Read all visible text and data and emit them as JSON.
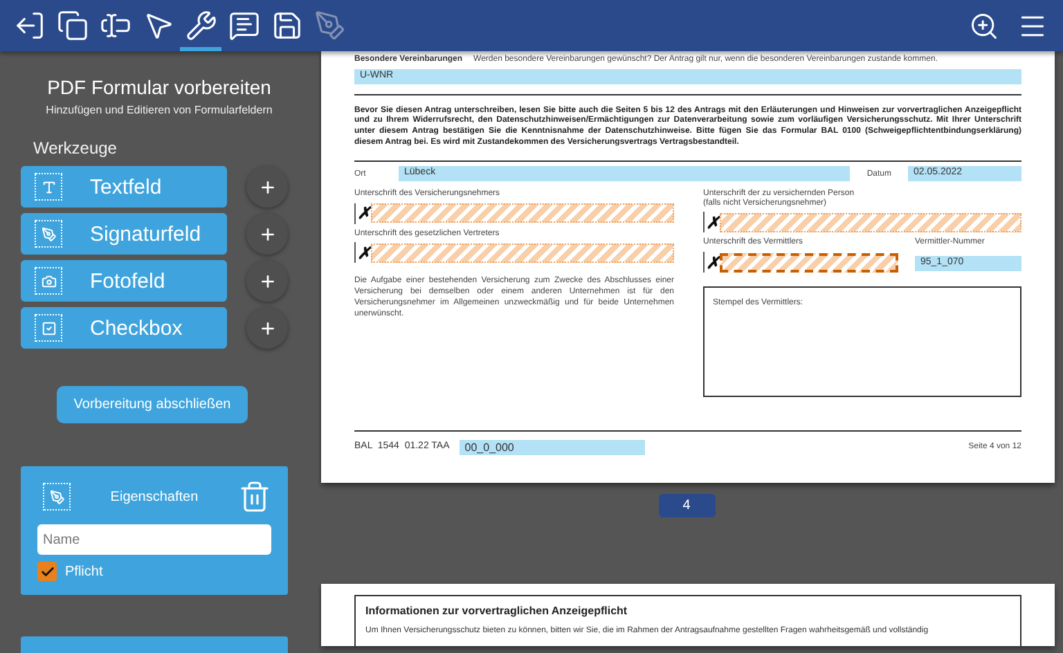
{
  "toolbar": {
    "tools": [
      {
        "kind": "exit",
        "selected": false,
        "disabled": false
      },
      {
        "kind": "pages",
        "selected": false,
        "disabled": false
      },
      {
        "kind": "field",
        "selected": false,
        "disabled": false
      },
      {
        "kind": "pointer",
        "selected": false,
        "disabled": false
      },
      {
        "kind": "tools",
        "selected": true,
        "disabled": false
      },
      {
        "kind": "comment",
        "selected": false,
        "disabled": false
      },
      {
        "kind": "save",
        "selected": false,
        "disabled": false
      },
      {
        "kind": "pen",
        "selected": false,
        "disabled": true
      }
    ],
    "right_tools": [
      {
        "kind": "zoom"
      },
      {
        "kind": "menu"
      }
    ]
  },
  "sidebar": {
    "title": "PDF Formular vorbereiten",
    "subtitle": "Hinzufügen und Editieren von Formularfeldern",
    "tools_heading": "Werkzeuge",
    "tools": [
      {
        "kind": "text",
        "label": "Textfeld"
      },
      {
        "kind": "signature",
        "label": "Signaturfeld"
      },
      {
        "kind": "photo",
        "label": "Fotofeld"
      },
      {
        "kind": "checkbox",
        "label": "Checkbox"
      }
    ],
    "finish_button": "Vorbereitung abschließen",
    "properties": {
      "kind": "signature",
      "title": "Eigenschaften",
      "name_placeholder": "Name",
      "required": {
        "label": "Pflicht",
        "checked": true
      }
    }
  },
  "document": {
    "page": {
      "special_agreements": {
        "label": "Besondere Vereinbarungen",
        "note": "Werden besondere Vereinbarungen gewünscht? Der Antrag gilt nur, wenn die besonderen Vereinbarungen zustande kommen.",
        "value": "U-WNR"
      },
      "notice": "Bevor Sie diesen Antrag unterschreiben, lesen Sie bitte auch die Seiten 5 bis 12 des Antrags mit den Erläuterungen und Hinweisen zur vorvertraglichen Anzeigepflicht und zu Ihrem Widerrufsrecht, den Datenschutzhinweisen/Ermächtigungen zur Datenverarbeitung sowie zum vorläufigen Versicherungsschutz. Mit Ihrer Unterschrift unter diesem Antrag bestätigen Sie die Kenntnisnahme der Datenschutzhinweise. Bitte fügen Sie das Formular BAL 0100 (Schweigepflichtentbindungserklärung) diesem Antrag bei. Es wird mit Zustandekommen des Versicherungsvertrags Vertragsbestandteil.",
      "place": {
        "label": "Ort",
        "value": "Lübeck"
      },
      "date": {
        "label": "Datum",
        "value": "02.05.2022"
      },
      "signatures": [
        {
          "label": "Unterschrift des Versicherungsnehmers",
          "mark": "✗",
          "selected": false
        },
        {
          "label": "Unterschrift der zu versichernden Person\n(falls nicht Versicherungsnehmer)",
          "mark": "✗",
          "selected": false
        },
        {
          "label": "Unterschrift des gesetzlichen Vertreters",
          "mark": "✗",
          "selected": false
        },
        {
          "label": "Unterschrift des Vermittlers",
          "mark": "✗",
          "selected": true
        }
      ],
      "agent_number": {
        "label": "Vermittler-Nummer",
        "value": "95_1_070"
      },
      "disclaimer": "Die Aufgabe einer bestehenden Versicherung zum Zwecke des Abschlusses einer Versicherung bei demselben oder einem anderen Unternehmen ist für den Versicherungsnehmer im Allgemeinen unzweckmäßig und für beide Unternehmen unerwünscht.",
      "stamp": {
        "label": "Stempel des Vermittlers:"
      },
      "footer": {
        "code": "BAL  1544  01.22 TAA",
        "field_value": "00_0_000",
        "page_info": "Seite 4 von 12"
      }
    },
    "page_number": "4",
    "next_page": {
      "heading": "Informationen zur vorvertraglichen Anzeigepflicht",
      "text": "Um Ihnen Versicherungsschutz bieten zu können, bitten wir Sie, die im Rahmen der Antragsaufnahme gestellten Fragen wahrheitsgemäß und vollständig"
    }
  }
}
